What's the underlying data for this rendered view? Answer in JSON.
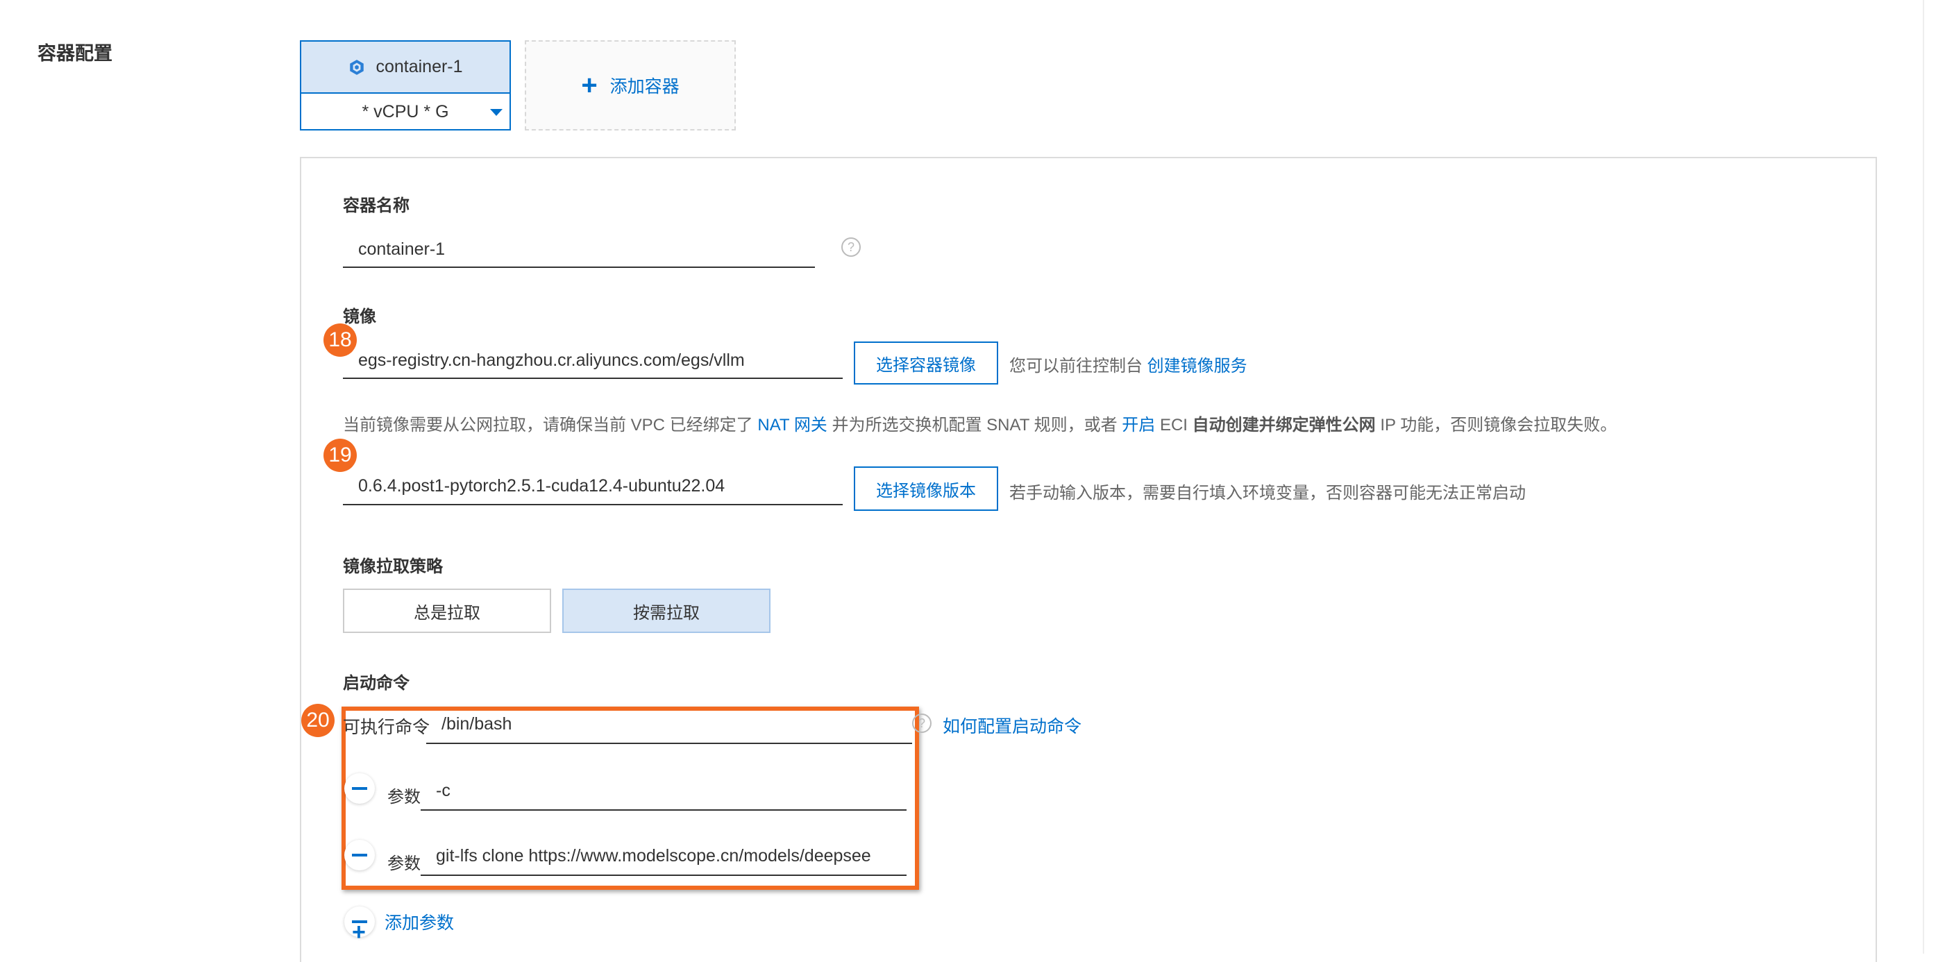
{
  "section": {
    "title": "容器配置"
  },
  "container_tabs": [
    {
      "name": "container-1",
      "spec": "* vCPU * G"
    }
  ],
  "add_container": {
    "label": "添加容器"
  },
  "container_name": {
    "label": "容器名称",
    "value": "container-1"
  },
  "image": {
    "label": "镜像",
    "value": "egs-registry.cn-hangzhou.cr.aliyuncs.com/egs/vllm",
    "select_button": "选择容器镜像",
    "hint_prefix": "您可以前往控制台",
    "hint_link": "创建镜像服务"
  },
  "pull_notice": {
    "t1": "当前镜像需要从公网拉取，请确保当前 VPC 已经绑定了",
    "link1": "NAT 网关",
    "t2": "并为所选交换机配置 SNAT 规则，或者",
    "link2": "开启",
    "t3": "ECI",
    "bold": "自动创建并绑定弹性公网",
    "t4": "IP 功能，否则镜像会拉取失败。"
  },
  "image_version": {
    "value": "0.6.4.post1-pytorch2.5.1-cuda12.4-ubuntu22.04",
    "select_button": "选择镜像版本",
    "hint": "若手动输入版本，需要自行填入环境变量，否则容器可能无法正常启动"
  },
  "pull_policy": {
    "label": "镜像拉取策略",
    "options": [
      "总是拉取",
      "按需拉取"
    ],
    "selected": "按需拉取"
  },
  "startup": {
    "label": "启动命令",
    "exec_label": "可执行命令",
    "exec_value": "/bin/bash",
    "help_link": "如何配置启动命令",
    "param_label": "参数",
    "params": [
      "-c",
      "git-lfs clone https://www.modelscope.cn/models/deepsee"
    ],
    "add_param": "添加参数"
  },
  "badges": [
    "18",
    "19",
    "20"
  ],
  "colors": {
    "accent": "#0070cc",
    "badge": "#f26a21",
    "selected_bg": "#d8e6f6"
  }
}
